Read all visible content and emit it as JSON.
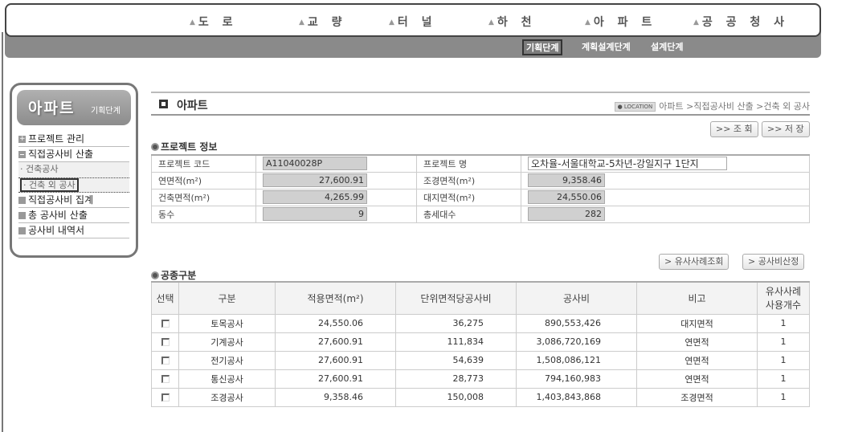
{
  "top_nav": {
    "items": [
      {
        "label": "도 로"
      },
      {
        "label": "교 량"
      },
      {
        "label": "터 널"
      },
      {
        "label": "하 천"
      },
      {
        "label": "아 파 트"
      },
      {
        "label": "공 공 청 사"
      }
    ],
    "stages": [
      {
        "label": "기획단계",
        "active": true
      },
      {
        "label": "계획설계단계",
        "active": false
      },
      {
        "label": "설계단계",
        "active": false
      }
    ]
  },
  "sidebar": {
    "title": "아파트",
    "subtitle": "기획단계",
    "items": [
      {
        "label": "프로젝트 관리",
        "icon": "plus-box-icon"
      },
      {
        "label": "직접공사비 산출",
        "icon": "minus-box-icon",
        "children": [
          {
            "label": "· 건축공사"
          },
          {
            "label": "· 건축 외 공사",
            "selected": true
          }
        ]
      },
      {
        "label": "직접공사비 집계",
        "icon": "box-icon"
      },
      {
        "label": "총 공사비 산출",
        "icon": "box-icon"
      },
      {
        "label": "공사비 내역서",
        "icon": "box-icon"
      }
    ]
  },
  "header": {
    "title": "아파트",
    "location_tag": "● LOCATION",
    "breadcrumb": "아파트 >직접공사비 산출 >건축 외 공사",
    "buttons": {
      "search": ">> 조 회",
      "save": ">> 저 장"
    }
  },
  "project_info": {
    "section_title": "프로젝트 정보",
    "rows": [
      {
        "l1": "프로젝트 코드",
        "v1": "A11040028P",
        "l2": "프로젝트 명",
        "v2": "오차율-서울대학교-5차년-강일지구 1단지"
      },
      {
        "l1": "연면적(m²)",
        "v1": "27,600.91",
        "l2": "조경면적(m²)",
        "v2": "9,358.46"
      },
      {
        "l1": "건축면적(m²)",
        "v1": "4,265.99",
        "l2": "대지면적(m²)",
        "v2": "24,550.06"
      },
      {
        "l1": "동수",
        "v1": "9",
        "l2": "총세대수",
        "v2": "282"
      }
    ]
  },
  "trade": {
    "section_title": "공종구분",
    "buttons": {
      "similar": "> 유사사례조회",
      "calc": "> 공사비산정"
    },
    "headers": [
      "선택",
      "구분",
      "적용면적(m²)",
      "단위면적당공사비",
      "공사비",
      "비고",
      "유사사례\n사용개수"
    ],
    "header_similar_1": "유사사례",
    "header_similar_2": "사용개수",
    "rows": [
      {
        "name": "토목공사",
        "area": "24,550.06",
        "unit_cost": "36,275",
        "cost": "890,553,426",
        "note": "대지면적",
        "count": "1"
      },
      {
        "name": "기계공사",
        "area": "27,600.91",
        "unit_cost": "111,834",
        "cost": "3,086,720,169",
        "note": "연면적",
        "count": "1"
      },
      {
        "name": "전기공사",
        "area": "27,600.91",
        "unit_cost": "54,639",
        "cost": "1,508,086,121",
        "note": "연면적",
        "count": "1"
      },
      {
        "name": "통신공사",
        "area": "27,600.91",
        "unit_cost": "28,773",
        "cost": "794,160,983",
        "note": "연면적",
        "count": "1"
      },
      {
        "name": "조경공사",
        "area": "9,358.46",
        "unit_cost": "150,008",
        "cost": "1,403,843,868",
        "note": "조경면적",
        "count": "1"
      }
    ]
  }
}
